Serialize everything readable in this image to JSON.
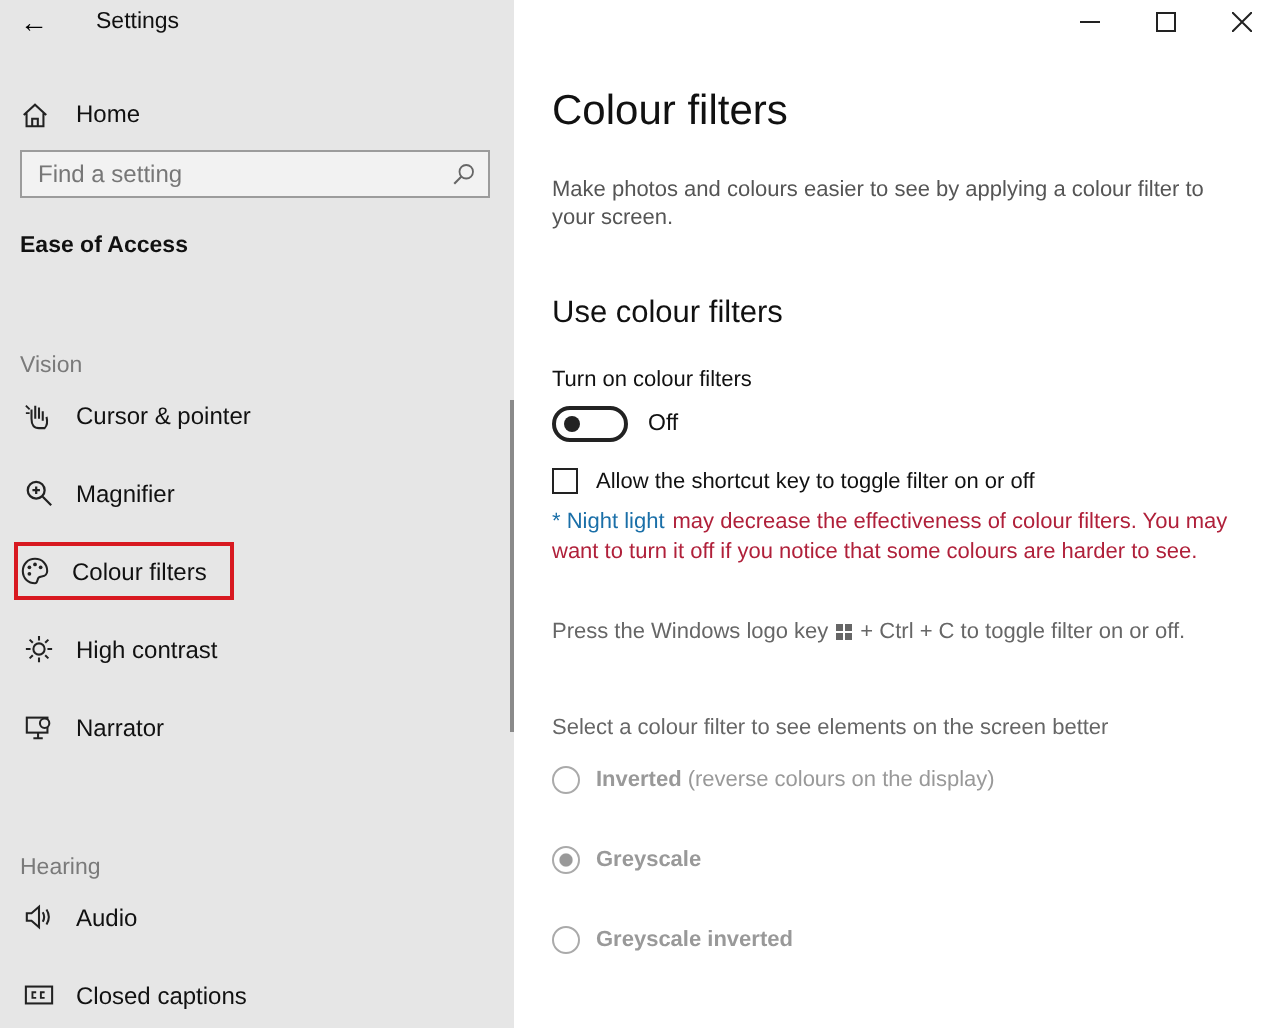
{
  "window": {
    "title": "Settings",
    "back": "←"
  },
  "sidebar": {
    "home": "Home",
    "search": {
      "placeholder": "Find a setting"
    },
    "section_title": "Ease of Access",
    "groups": [
      {
        "heading": "Vision",
        "items": [
          {
            "label": "Cursor & pointer",
            "kind": "cursor",
            "highlighted": false
          },
          {
            "label": "Magnifier",
            "kind": "magnifier",
            "highlighted": false
          },
          {
            "label": "Colour filters",
            "kind": "palette",
            "highlighted": true
          },
          {
            "label": "High contrast",
            "kind": "sun",
            "highlighted": false
          },
          {
            "label": "Narrator",
            "kind": "narrator",
            "highlighted": false
          }
        ]
      },
      {
        "heading": "Hearing",
        "items": [
          {
            "label": "Audio",
            "kind": "speaker",
            "highlighted": false
          },
          {
            "label": "Closed captions",
            "kind": "cc",
            "highlighted": false
          }
        ]
      }
    ]
  },
  "page": {
    "title": "Colour filters",
    "description": "Make photos and colours easier to see by applying a colour filter to your screen.",
    "section": "Use colour filters",
    "toggle": {
      "label": "Turn on colour filters",
      "on": false,
      "state_text": "Off"
    },
    "checkbox": {
      "label": "Allow the shortcut key to toggle filter on or off",
      "checked": false
    },
    "warning": {
      "link": "* Night light",
      "text": "may decrease the effectiveness of colour filters. You may want to turn it off if you notice that some colours are harder to see."
    },
    "shortcut_hint": {
      "before": "Press the Windows logo key",
      "after": "+ Ctrl + C to toggle filter on or off."
    },
    "filter_prompt": "Select a colour filter to see elements on the screen better",
    "filters": [
      {
        "label": "Inverted",
        "note": "(reverse colours on the display)",
        "selected": false,
        "disabled": true
      },
      {
        "label": "Greyscale",
        "selected": true,
        "disabled": true
      },
      {
        "label": "Greyscale inverted",
        "selected": false,
        "disabled": true
      }
    ]
  }
}
